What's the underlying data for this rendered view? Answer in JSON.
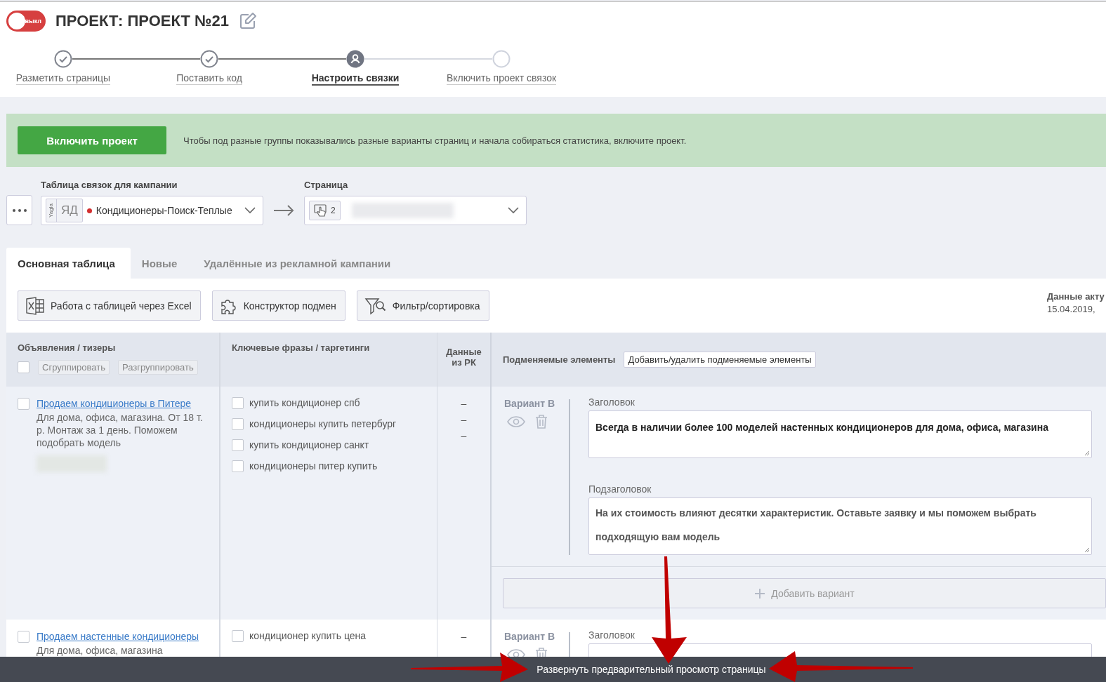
{
  "toggle": {
    "label": "выкл",
    "on": false
  },
  "title": "ПРОЕКТ: ПРОЕКТ №21",
  "steps": [
    {
      "label": "Разметить страницы",
      "checked": true,
      "selected": false
    },
    {
      "label": "Поставить код",
      "checked": true,
      "selected": false
    },
    {
      "label": "Настроить связки",
      "checked": false,
      "selected": true
    },
    {
      "label": "Включить проект связок",
      "checked": false,
      "selected": false
    }
  ],
  "banner": {
    "button": "Включить проект",
    "message": "Чтобы под разные группы показывались разные варианты страниц и начала собираться статистика, включите проект."
  },
  "campaign": {
    "label": "Таблица связок для кампании",
    "source_tag": "Yagla",
    "network": "ЯД",
    "color": "#d32f2f",
    "value": "Кондиционеры-Поиск-Теплые"
  },
  "page": {
    "label": "Страница",
    "count": "2"
  },
  "tabs": [
    {
      "label": "Основная таблица",
      "selected": true
    },
    {
      "label": "Новые",
      "selected": false
    },
    {
      "label": "Удалённые из рекламной кампании",
      "selected": false
    }
  ],
  "tools": [
    {
      "label": "Работа с таблицей через Excel",
      "kind": "excel"
    },
    {
      "label": "Конструктор подмен",
      "kind": "puzzle"
    },
    {
      "label": "Фильтр/сортировка",
      "kind": "filter"
    }
  ],
  "data_info": {
    "label": "Данные акту",
    "date": "15.04.2019,"
  },
  "table": {
    "columns": [
      "Объявления / тизеры",
      "Ключевые фразы / таргетинги",
      "Данные из РК",
      "Подменяемые элементы"
    ],
    "all_checked": false,
    "group_buttons": [
      "Сгруппировать",
      "Разгруппировать"
    ],
    "edit_elements_button": "Добавить/удалить подменяемые элементы",
    "rows": [
      {
        "checked": false,
        "ad_title": "Продаем кондиционеры в Питере",
        "ad_text": "Для дома, офиса, магазина. От 18 т. р. Монтаж за 1 день. Поможем подобрать модель",
        "keywords": [
          {
            "text": "купить кондиционер спб",
            "checked": false
          },
          {
            "text": "кондиционеры купить петербург",
            "checked": false
          },
          {
            "text": "купить кондиционер санкт",
            "checked": false
          },
          {
            "text": "кондиционеры питер купить",
            "checked": false
          }
        ],
        "rk_data": [
          "–",
          "–",
          "–"
        ],
        "variants": [
          {
            "name": "Вариант B",
            "fields": [
              {
                "label": "Заголовок",
                "value": "Всегда в наличии более 100 моделей настенных кондиционеров для дома, офиса, магазина"
              },
              {
                "label": "Подзаголовок",
                "value": "На их стоимость влияют десятки характеристик. Оставьте заявку и мы поможем выбрать подходящую вам модель"
              }
            ]
          }
        ],
        "add_variant": "Добавить вариант"
      },
      {
        "checked": false,
        "ad_title": "Продаем настенные кондиционеры",
        "ad_text": "Для дома, офиса, магазина",
        "keywords": [
          {
            "text": "кондиционер купить цена",
            "checked": false
          }
        ],
        "rk_data": [
          "–"
        ],
        "variants": [
          {
            "name": "Вариант B",
            "fields": [
              {
                "label": "Заголовок"
              }
            ]
          }
        ]
      }
    ]
  },
  "bottom_bar": {
    "label": "Развернуть предварительный просмотр страницы"
  }
}
